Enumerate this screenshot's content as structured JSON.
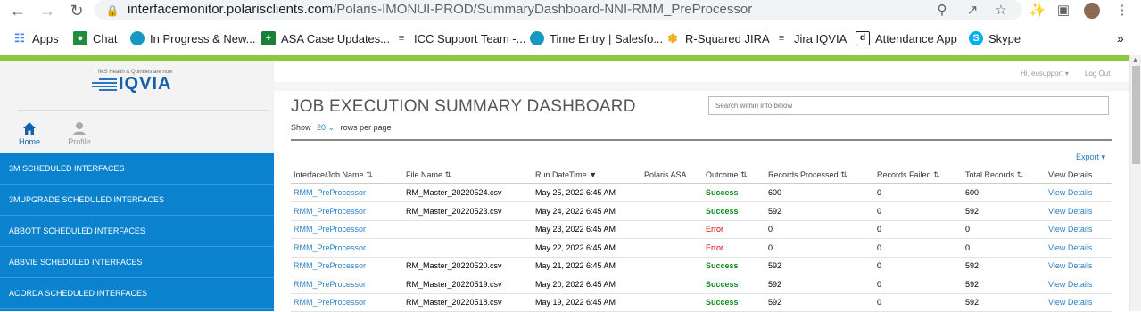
{
  "browser": {
    "url_host": "interfacemonitor.polarisclients.com",
    "url_path": "/Polaris-IMONUI-PROD/SummaryDashboard-NNI-RMM_PreProcessor",
    "bookmarks": [
      {
        "label": "Apps",
        "icon": "apps-grid-icon",
        "color": "#4285f4"
      },
      {
        "label": "Chat",
        "icon": "chat-icon",
        "color": "#1e8e3e"
      },
      {
        "label": "In Progress & New...",
        "icon": "salesforce-cloud-icon",
        "color": "#1798c1"
      },
      {
        "label": "ASA Case Updates...",
        "icon": "plus-sheet-icon",
        "color": "#188038"
      },
      {
        "label": "ICC Support Team -...",
        "icon": "list-icon",
        "color": "#5f6368"
      },
      {
        "label": "Time Entry | Salesfo...",
        "icon": "salesforce-cloud-icon",
        "color": "#1798c1"
      },
      {
        "label": "R-Squared JIRA",
        "icon": "jira-icon",
        "color": "#f0a000"
      },
      {
        "label": "Jira IQVIA",
        "icon": "list-icon",
        "color": "#5f6368"
      },
      {
        "label": "Attendance App",
        "icon": "d-app-icon",
        "color": "#222222"
      },
      {
        "label": "Skype",
        "icon": "skype-icon",
        "color": "#00aff0"
      }
    ],
    "more_bookmarks": "»"
  },
  "sidebar": {
    "logo_tagline": "IMS Health & Quintiles are now",
    "logo_word": "IQVIA",
    "tabs": [
      {
        "label": "Home",
        "icon": "home-icon",
        "active": true
      },
      {
        "label": "Profile",
        "icon": "user-icon",
        "active": false
      }
    ],
    "menu": [
      "3M SCHEDULED INTERFACES",
      "3MUPGRADE SCHEDULED INTERFACES",
      "ABBOTT SCHEDULED INTERFACES",
      "ABBVIE SCHEDULED INTERFACES",
      "ACORDA SCHEDULED INTERFACES"
    ]
  },
  "header": {
    "user": "Hi, eusupport",
    "logout": "Log Out"
  },
  "main": {
    "title": "JOB EXECUTION SUMMARY DASHBOARD",
    "search_placeholder": "Search within info below",
    "show_label": "Show",
    "rows_per_page": "20",
    "rows_suffix": "rows per page",
    "export": "Export",
    "columns": [
      "Interface/Job Name",
      "File Name",
      "Run DateTime",
      "Polaris ASA",
      "Outcome",
      "Records Processed",
      "Records Failed",
      "Total Records",
      "View Details"
    ],
    "rows": [
      {
        "job": "RMM_PreProcessor",
        "file": "RM_Master_20220524.csv",
        "run": "May 25, 2022 6:45 AM",
        "asa": "",
        "outcome": "Success",
        "processed": "600",
        "failed": "0",
        "total": "600",
        "view": "View Details"
      },
      {
        "job": "RMM_PreProcessor",
        "file": "RM_Master_20220523.csv",
        "run": "May 24, 2022 6:45 AM",
        "asa": "",
        "outcome": "Success",
        "processed": "592",
        "failed": "0",
        "total": "592",
        "view": "View Details"
      },
      {
        "job": "RMM_PreProcessor",
        "file": "",
        "run": "May 23, 2022 6:45 AM",
        "asa": "",
        "outcome": "Error",
        "processed": "0",
        "failed": "0",
        "total": "0",
        "view": "View Details"
      },
      {
        "job": "RMM_PreProcessor",
        "file": "",
        "run": "May 22, 2022 6:45 AM",
        "asa": "",
        "outcome": "Error",
        "processed": "0",
        "failed": "0",
        "total": "0",
        "view": "View Details"
      },
      {
        "job": "RMM_PreProcessor",
        "file": "RM_Master_20220520.csv",
        "run": "May 21, 2022 6:45 AM",
        "asa": "",
        "outcome": "Success",
        "processed": "592",
        "failed": "0",
        "total": "592",
        "view": "View Details"
      },
      {
        "job": "RMM_PreProcessor",
        "file": "RM_Master_20220519.csv",
        "run": "May 20, 2022 6:45 AM",
        "asa": "",
        "outcome": "Success",
        "processed": "592",
        "failed": "0",
        "total": "592",
        "view": "View Details"
      },
      {
        "job": "RMM_PreProcessor",
        "file": "RM_Master_20220518.csv",
        "run": "May 19, 2022 6:45 AM",
        "asa": "",
        "outcome": "Success",
        "processed": "592",
        "failed": "0",
        "total": "592",
        "view": "View Details"
      }
    ]
  },
  "colors": {
    "accent_blue": "#0a82ce",
    "link_blue": "#2a7fc4",
    "success_green": "#0f8c1b",
    "error_red": "#dd0000",
    "brand_green_strip": "#8dc63f"
  }
}
